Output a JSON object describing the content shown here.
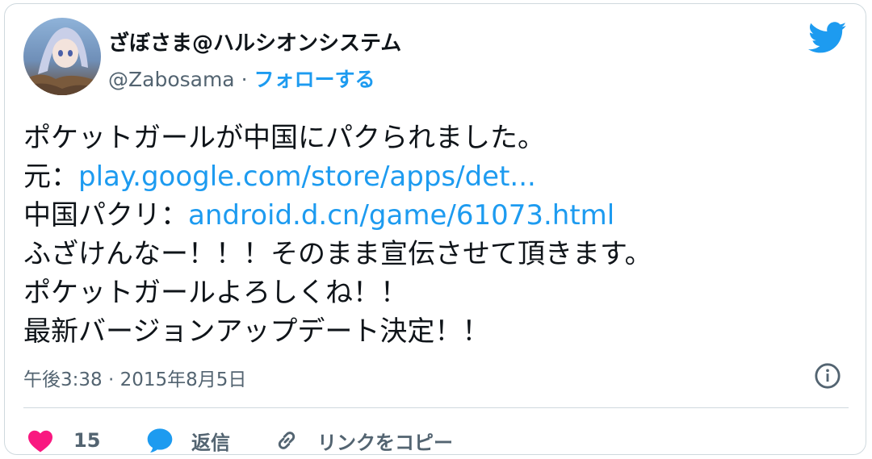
{
  "user": {
    "display_name": "ざぼさま@ハルシオンシステム",
    "handle": "@Zabosama",
    "separator": " · ",
    "follow_label": "フォローする"
  },
  "tweet": {
    "lines": [
      {
        "text": "ポケットガールが中国にパクられました。"
      },
      {
        "prefix": "元：",
        "link": "play.google.com/store/apps/det..."
      },
      {
        "prefix": "中国パクリ：",
        "link": "android.d.cn/game/61073.html"
      },
      {
        "text": "ふざけんなー！！！そのまま宣伝させて頂きます。"
      },
      {
        "text": "ポケットガールよろしくね！！"
      },
      {
        "text": "最新バージョンアップデート決定！！"
      }
    ]
  },
  "meta": {
    "time": "午後3:38",
    "separator": " · ",
    "date": "2015年8月5日"
  },
  "actions": {
    "like_count": "15",
    "reply_label": "返信",
    "copy_link_label": "リンクをコピー"
  },
  "colors": {
    "accent": "#1d9bf0",
    "like": "#f91880",
    "text": "#0f1419",
    "secondary": "#536471"
  },
  "icons": [
    "twitter-bird-icon",
    "info-icon",
    "heart-icon",
    "reply-bubble-icon",
    "link-icon"
  ]
}
